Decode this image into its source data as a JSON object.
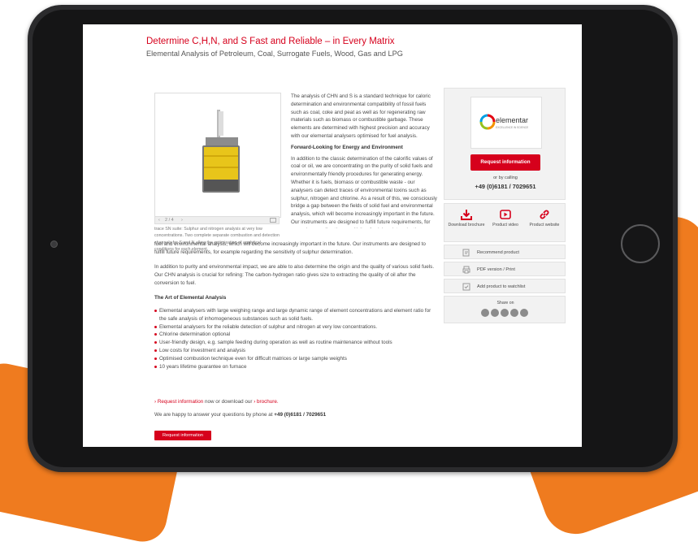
{
  "page": {
    "title": "Determine C,H,N, and S Fast and Reliable – in Every Matrix",
    "subtitle": "Elemental Analysis of Petroleum, Coal, Surrogate Fuels, Wood, Gas and LPG"
  },
  "gallery": {
    "counter": "2 / 4",
    "prev": "‹",
    "next": "›",
    "caption": "trace SN suite: Sulphur and nitrogen analysis at very low concentrations. Two complete separate combustion and detection channels for S and N allow the optimisation of analytical conditions for each element."
  },
  "content": {
    "intro": "The analysis of CHN and S is a standard technique for caloric determination and environmental compatibility of fossil fuels such as coal, coke and peat as well as for regenerating raw materials such as biomass or combustible garbage. These elements are determined with highest precision and accuracy with our elemental analysers optimised for fuel analysis.",
    "forward_heading": "Forward-Looking for Energy and Environment",
    "forward_text": "In addition to the classic determination of the calorific values of coal or oil, we are concentrating on the purity of solid fuels and environmentally friendly procedures for generating energy. Whether it is fuels, biomass or combustible waste - our analysers can detect traces of environmental toxins such as sulphur, nitrogen and chlorine. As a result of this, we consciously bridge a gap between the fields of solid fuel and environmental analysis, which will become increasingly important in the future. Our instruments are designed to fulfill future requirements, for example regarding the sensitivity of sulphur determination.",
    "para2": "In addition to purity and environmental impact, we are able to also determine the origin and the quality of various solid fuels. Our CHN analysis is crucial for refining: The carbon-hydrogen ratio gives size to extracting the quality of oil after the conversion to fuel.",
    "art_heading": "The Art of Elemental Analysis",
    "features": [
      "Elemental analysers with large weighing range and large dynamic range of element concentrations and element ratio for the safe analysis of inhomogeneous substances such as solid fuels.",
      "Elemental analysers for the reliable detection of sulphur and nitrogen at very low concentrations.",
      "Chlorine determination optional",
      "User-friendly design, e.g. sample feeding during operation as well as routine maintenance without tools",
      "Low costs for investment and analysis",
      "Optimised combustion technique even for difficult matrices or large sample weights",
      "10 years lifetime guarantee on furnace"
    ],
    "cta_arrow1": "›",
    "cta_request": "Request information",
    "cta_mid": " now or download our ",
    "cta_arrow2": "›",
    "cta_brochure": "brochure.",
    "phone_prefix": "We are happy to answer your questions by phone at ",
    "phone": "+49 (0)6181 / 7029651",
    "button": "Request information"
  },
  "sidebar": {
    "logo_text": "elementar",
    "logo_tagline": "EXCELLENCE IN SCIENCE",
    "request_button": "Request information",
    "calling_label": "or by calling",
    "phone": "+49 (0)6181 / 7029651",
    "actions": [
      {
        "label": "Download brochure",
        "icon": "download-icon"
      },
      {
        "label": "Product video",
        "icon": "video-icon"
      },
      {
        "label": "Product website",
        "icon": "link-icon"
      }
    ],
    "recommend": "Recommend product",
    "pdf": "PDF version / Print",
    "watchlist": "Add product to watchlist",
    "share_label": "Share on",
    "share_icons": [
      "xing-icon",
      "linkedin-icon",
      "facebook-icon",
      "twitter-icon",
      "email-icon"
    ]
  },
  "colors": {
    "accent": "#d6001c",
    "background": "#ef7b1f",
    "tablet": "#2b2b2d"
  }
}
